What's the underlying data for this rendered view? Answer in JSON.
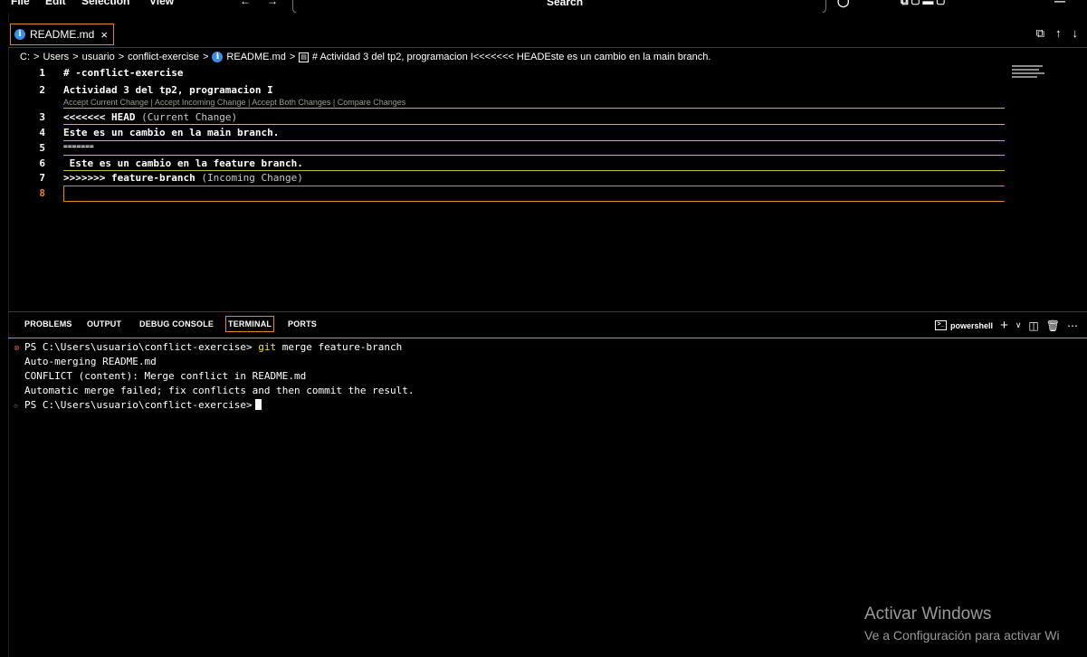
{
  "menubar": {
    "items": [
      "File",
      "Edit",
      "Selection",
      "View"
    ],
    "search_text": "Search"
  },
  "tab": {
    "label": "README.md",
    "close": "×"
  },
  "breadcrumb": {
    "parts": [
      "C:",
      "Users",
      "usuario",
      "conflict-exercise",
      "README.md",
      "# Actividad 3 del tp2, programacion I<<<<<<< HEADEste es un cambio en la main branch."
    ],
    "sep": ">"
  },
  "editor": {
    "codelens": "Accept Current Change | Accept Incoming Change | Accept Both Changes | Compare Changes",
    "lines": [
      {
        "num": "1",
        "text": "# -conflict-exercise",
        "extra": ""
      },
      {
        "num": "2",
        "text": "Actividad 3 del tp2, programacion I",
        "extra": ""
      },
      {
        "num": "3",
        "text": "<<<<<<< HEAD",
        "extra": " (Current Change)"
      },
      {
        "num": "4",
        "text": "Este es un cambio en la main branch.",
        "extra": ""
      },
      {
        "num": "5",
        "text": "=======",
        "extra": ""
      },
      {
        "num": "6",
        "text": " Este es un cambio en la feature branch.",
        "extra": ""
      },
      {
        "num": "7",
        "text": ">>>>>>> feature-branch",
        "extra": " (Incoming Change)"
      },
      {
        "num": "8",
        "text": "",
        "extra": ""
      }
    ]
  },
  "panel": {
    "tabs": [
      "PROBLEMS",
      "OUTPUT",
      "DEBUG CONSOLE",
      "TERMINAL",
      "PORTS"
    ],
    "active_tab": "TERMINAL",
    "shell": "powershell"
  },
  "terminal": {
    "prompt1": "PS C:\\Users\\usuario\\conflict-exercise> ",
    "cmd_git": "git",
    "cmd_rest": " merge feature-branch",
    "out1": "Auto-merging README.md",
    "out2": "CONFLICT (content): Merge conflict in README.md",
    "out3": "Automatic merge failed; fix conflicts and then commit the result.",
    "prompt2": "PS C:\\Users\\usuario\\conflict-exercise>"
  },
  "watermark": {
    "title": "Activar Windows",
    "subtitle": "Ve a Configuración para activar Wi"
  },
  "colors": {
    "accent": "#e8821e",
    "conflict_line": "#c9b53a",
    "info_icon": "#3a8fe6",
    "git_keyword": "#f0e046",
    "error_marker": "#e05252"
  }
}
